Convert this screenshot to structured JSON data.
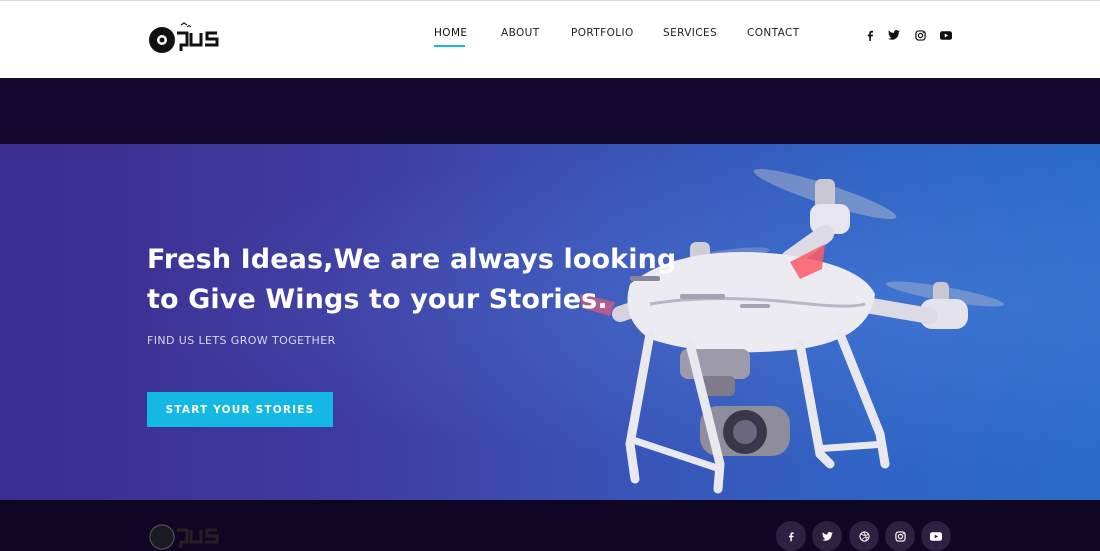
{
  "header": {
    "logo_alt": "Opus",
    "nav": [
      {
        "label": "HOME",
        "active": true
      },
      {
        "label": "ABOUT",
        "active": false
      },
      {
        "label": "PORTFOLIO",
        "active": false
      },
      {
        "label": "SERVICES",
        "active": false
      },
      {
        "label": "CONTACT",
        "active": false
      }
    ],
    "social": [
      "facebook-icon",
      "twitter-icon",
      "instagram-icon",
      "youtube-icon"
    ]
  },
  "hero": {
    "title_line1": "Fresh Ideas,We are always looking",
    "title_line2": "to Give Wings to your Stories.",
    "subtitle": "FIND US LETS GROW TOGETHER",
    "cta_label": "START YOUR STORIES"
  },
  "footer": {
    "social": [
      "facebook-icon",
      "twitter-icon",
      "dribbble-icon",
      "instagram-icon",
      "youtube-icon"
    ]
  },
  "colors": {
    "accent": "#18b7d4",
    "cta": "#13b9e3",
    "dark": "#0f0626",
    "hero_start": "#3b2d8e",
    "hero_end": "#2b6bc8"
  }
}
